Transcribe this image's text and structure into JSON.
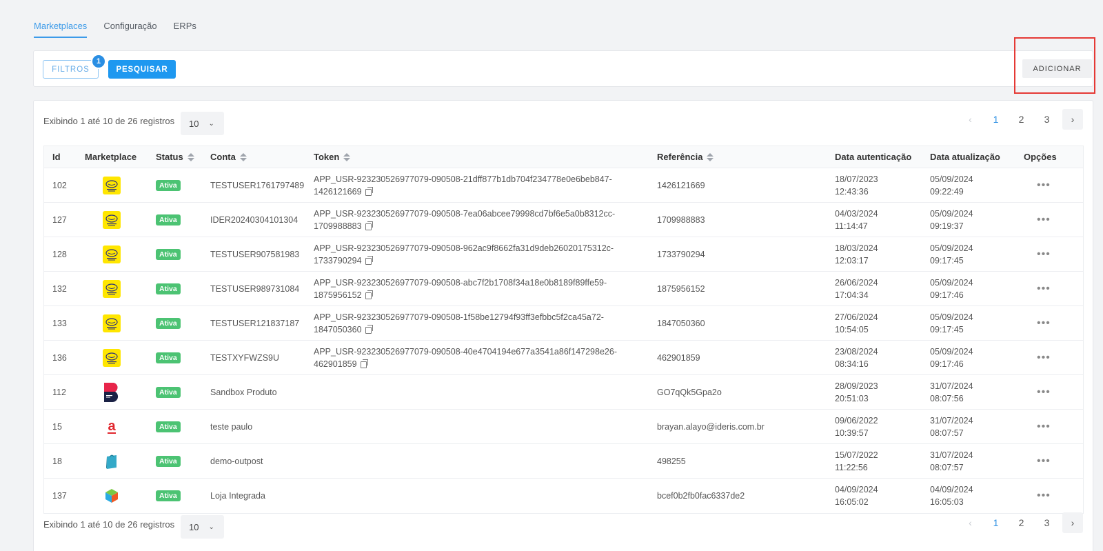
{
  "tabs": [
    {
      "label": "Marketplaces",
      "active": true
    },
    {
      "label": "Configuração",
      "active": false
    },
    {
      "label": "ERPs",
      "active": false
    }
  ],
  "toolbar": {
    "filtros_label": "FILTROS",
    "filtros_badge": "1",
    "pesquisar_label": "PESQUISAR",
    "adicionar_label": "ADICIONAR"
  },
  "summary": {
    "text": "Exibindo 1 até 10 de 26 registros",
    "page_size": "10"
  },
  "pagination": {
    "pages": [
      "1",
      "2",
      "3"
    ],
    "current": "1",
    "prev_icon": "chevron-left-icon",
    "next_icon": "chevron-right-icon"
  },
  "table": {
    "headers": {
      "id": "Id",
      "marketplace": "Marketplace",
      "status": "Status",
      "conta": "Conta",
      "token": "Token",
      "referencia": "Referência",
      "data_auth": "Data autenticação",
      "data_atual": "Data atualização",
      "opcoes": "Opções"
    },
    "rows": [
      {
        "id": "102",
        "logo": "mercado-livre",
        "status": "Ativa",
        "conta": "TESTUSER1761797489",
        "token1": "APP_USR-923230526977079-090508-21dff877b1db704f234778e0e6beb847-",
        "token2": "1426121669",
        "ref": "1426121669",
        "auth_date": "18/07/2023",
        "auth_time": "12:43:36",
        "upd_date": "05/09/2024",
        "upd_time": "09:22:49"
      },
      {
        "id": "127",
        "logo": "mercado-livre",
        "status": "Ativa",
        "conta": "IDER20240304101304",
        "token1": "APP_USR-923230526977079-090508-7ea06abcee79998cd7bf6e5a0b8312cc-",
        "token2": "1709988883",
        "ref": "1709988883",
        "auth_date": "04/03/2024",
        "auth_time": "11:14:47",
        "upd_date": "05/09/2024",
        "upd_time": "09:19:37"
      },
      {
        "id": "128",
        "logo": "mercado-livre",
        "status": "Ativa",
        "conta": "TESTUSER907581983",
        "token1": "APP_USR-923230526977079-090508-962ac9f8662fa31d9deb26020175312c-",
        "token2": "1733790294",
        "ref": "1733790294",
        "auth_date": "18/03/2024",
        "auth_time": "12:03:17",
        "upd_date": "05/09/2024",
        "upd_time": "09:17:45"
      },
      {
        "id": "132",
        "logo": "mercado-livre",
        "status": "Ativa",
        "conta": "TESTUSER989731084",
        "token1": "APP_USR-923230526977079-090508-abc7f2b1708f34a18e0b8189f89ffe59-",
        "token2": "1875956152",
        "ref": "1875956152",
        "auth_date": "26/06/2024",
        "auth_time": "17:04:34",
        "upd_date": "05/09/2024",
        "upd_time": "09:17:46"
      },
      {
        "id": "133",
        "logo": "mercado-livre",
        "status": "Ativa",
        "conta": "TESTUSER121837187",
        "token1": "APP_USR-923230526977079-090508-1f58be12794f93ff3efbbc5f2ca45a72-",
        "token2": "1847050360",
        "ref": "1847050360",
        "auth_date": "27/06/2024",
        "auth_time": "10:54:05",
        "upd_date": "05/09/2024",
        "upd_time": "09:17:45"
      },
      {
        "id": "136",
        "logo": "mercado-livre",
        "status": "Ativa",
        "conta": "TESTXYFWZS9U",
        "token1": "APP_USR-923230526977079-090508-40e4704194e677a3541a86f147298e26-",
        "token2": "462901859",
        "ref": "462901859",
        "auth_date": "23/08/2024",
        "auth_time": "08:34:16",
        "upd_date": "05/09/2024",
        "upd_time": "09:17:46"
      },
      {
        "id": "112",
        "logo": "b-marketplace",
        "status": "Ativa",
        "conta": "Sandbox Produto",
        "token1": "",
        "token2": "",
        "ref": "GO7qQk5Gpa2o",
        "auth_date": "28/09/2023",
        "auth_time": "20:51:03",
        "upd_date": "31/07/2024",
        "upd_time": "08:07:56"
      },
      {
        "id": "15",
        "logo": "americanas",
        "status": "Ativa",
        "conta": "teste paulo",
        "token1": "",
        "token2": "",
        "ref": "brayan.alayo@ideris.com.br",
        "auth_date": "09/06/2022",
        "auth_time": "10:39:57",
        "upd_date": "31/07/2024",
        "upd_time": "08:07:57"
      },
      {
        "id": "18",
        "logo": "outpost-bag",
        "status": "Ativa",
        "conta": "demo-outpost",
        "token1": "",
        "token2": "",
        "ref": "498255",
        "auth_date": "15/07/2022",
        "auth_time": "11:22:56",
        "upd_date": "31/07/2024",
        "upd_time": "08:07:57"
      },
      {
        "id": "137",
        "logo": "loja-integrada-cube",
        "status": "Ativa",
        "conta": "Loja Integrada",
        "token1": "",
        "token2": "",
        "ref": "bcef0b2fb0fac6337de2",
        "auth_date": "04/09/2024",
        "auth_time": "16:05:02",
        "upd_date": "04/09/2024",
        "upd_time": "16:05:03"
      }
    ]
  },
  "colors": {
    "accent": "#1e98f0",
    "status_active": "#4cc373",
    "highlight": "#e53935"
  }
}
